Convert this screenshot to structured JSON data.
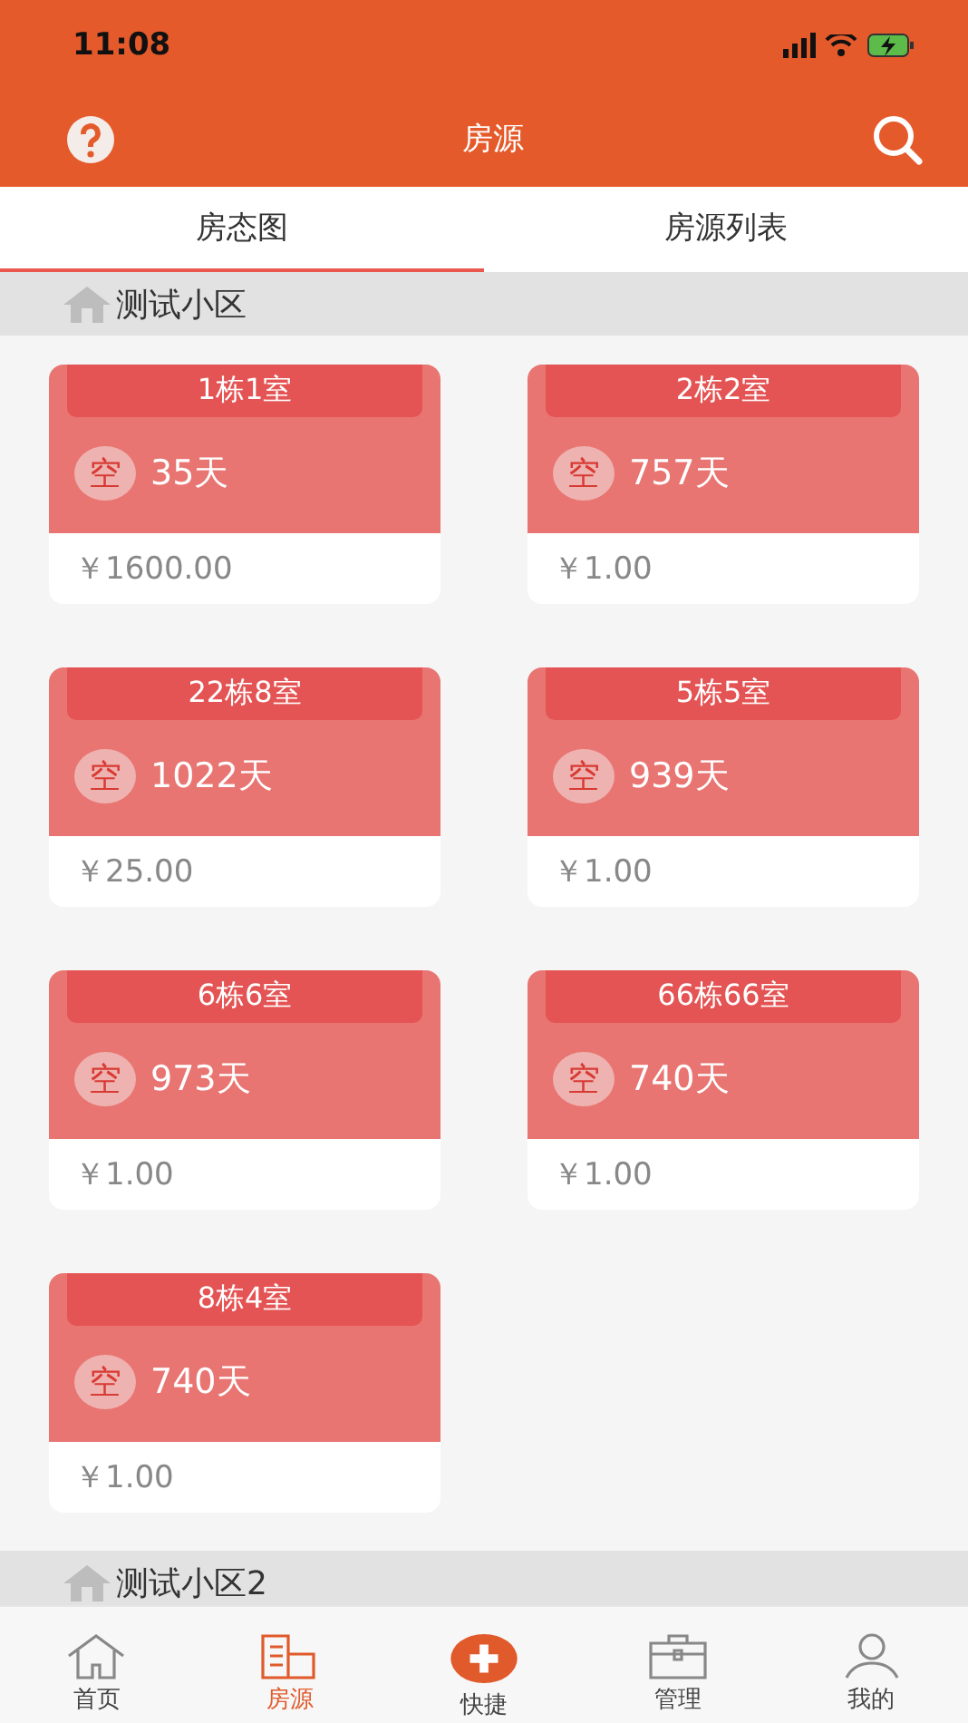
{
  "status_bar": {
    "time": "11:08"
  },
  "header": {
    "title": "房源"
  },
  "tabs": [
    {
      "label": "房态图",
      "selected": true
    },
    {
      "label": "房源列表",
      "selected": false
    }
  ],
  "sections": [
    {
      "name": "测试小区",
      "rooms": [
        {
          "room": "1栋1室",
          "status": "空",
          "days": "35天",
          "price": "￥1600.00"
        },
        {
          "room": "2栋2室",
          "status": "空",
          "days": "757天",
          "price": "￥1.00"
        },
        {
          "room": "22栋8室",
          "status": "空",
          "days": "1022天",
          "price": "￥25.00"
        },
        {
          "room": "5栋5室",
          "status": "空",
          "days": "939天",
          "price": "￥1.00"
        },
        {
          "room": "6栋6室",
          "status": "空",
          "days": "973天",
          "price": "￥1.00"
        },
        {
          "room": "66栋66室",
          "status": "空",
          "days": "740天",
          "price": "￥1.00"
        },
        {
          "room": "8栋4室",
          "status": "空",
          "days": "740天",
          "price": "￥1.00"
        }
      ]
    },
    {
      "name": "测试小区2"
    }
  ],
  "bottom_nav": [
    {
      "kind": "home",
      "label": "首页",
      "selected": false
    },
    {
      "kind": "building",
      "label": "房源",
      "selected": true
    },
    {
      "kind": "plus",
      "label": "快捷",
      "selected": false
    },
    {
      "kind": "briefcase",
      "label": "管理",
      "selected": false
    },
    {
      "kind": "user",
      "label": "我的",
      "selected": false
    }
  ]
}
